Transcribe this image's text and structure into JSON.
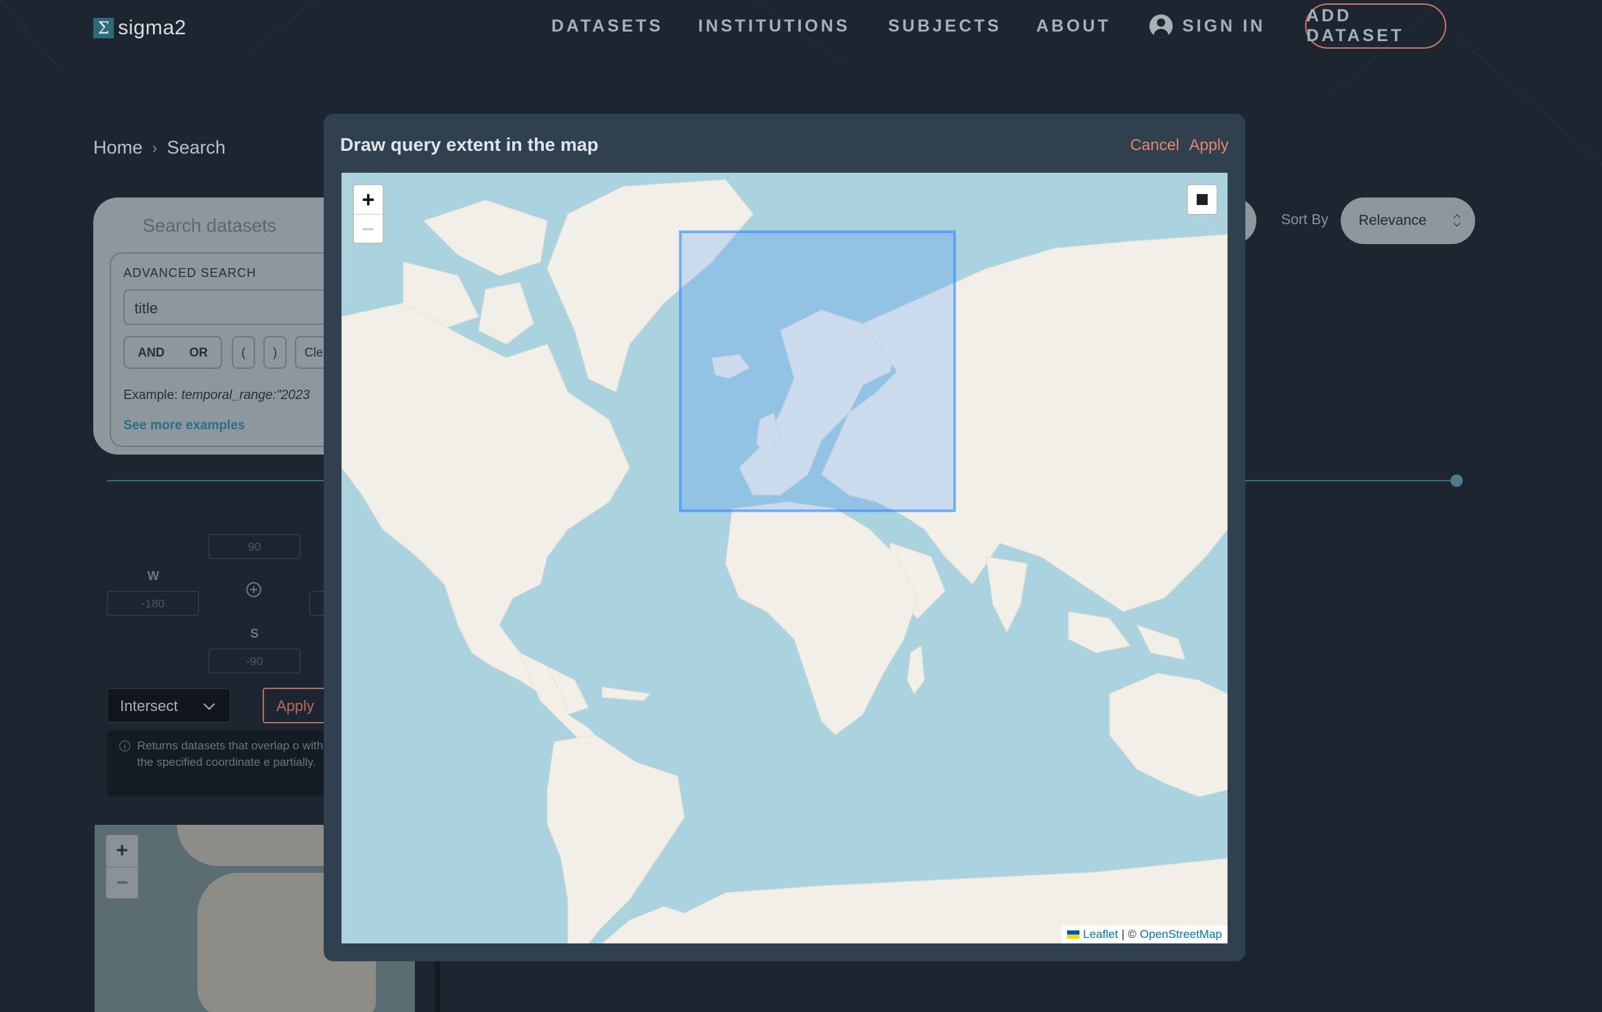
{
  "brand": {
    "name": "sigma2",
    "mark": "Σ"
  },
  "nav": {
    "datasets": "DATASETS",
    "institutions": "INSTITUTIONS",
    "subjects": "SUBJECTS",
    "about": "ABOUT",
    "sign_in": "SIGN IN",
    "add_dataset": "ADD DATASET"
  },
  "breadcrumb": {
    "home": "Home",
    "separator": "›",
    "current": "Search"
  },
  "search": {
    "placeholder": "Search datasets",
    "advanced_title": "ADVANCED SEARCH",
    "field_select": "title",
    "and": "AND",
    "or": "OR",
    "open_paren": "(",
    "close_paren": ")",
    "clear": "Cle",
    "example_label": "Example:",
    "example_value": "temporal_range:\"2023",
    "more_examples": "See more examples",
    "sort_label": "Sort By",
    "sort_value": "Relevance"
  },
  "spatial": {
    "n_placeholder": "90",
    "w_label": "W",
    "w_placeholder": "-180",
    "s_label": "S",
    "s_placeholder": "-90",
    "mode": "Intersect",
    "apply": "Apply",
    "info": "Returns datasets that overlap o with the specified coordinate e partially."
  },
  "modal": {
    "title": "Draw query extent in the map",
    "cancel": "Cancel",
    "apply": "Apply",
    "zoom_in": "+",
    "zoom_out": "−",
    "attribution_leaflet": "Leaflet",
    "attribution_sep": "| ©",
    "attribution_osm": "OpenStreetMap"
  },
  "colors": {
    "background": "#1c2530",
    "modal": "#30404f",
    "accent": "#e5876f",
    "water": "#aad3df",
    "land": "#f2efe9",
    "selection": "#3388ff"
  }
}
